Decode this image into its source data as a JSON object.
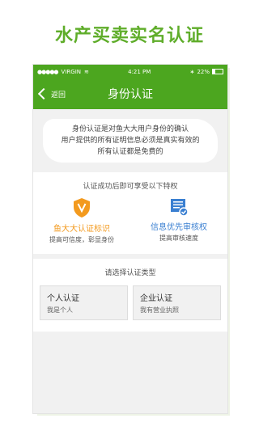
{
  "promo": {
    "title": "水产买卖实名认证"
  },
  "statusbar": {
    "carrier": "VIRGIN",
    "time": "4:21 PM",
    "battery": "22%"
  },
  "navbar": {
    "back_label": "返回",
    "title": "身份认证"
  },
  "notice": {
    "line1": "身份认证是对鱼大大用户身份的确认",
    "line2": "用户提供的所有证明信息必须是真实有效的",
    "line3": "所有认证都是免费的"
  },
  "perks": {
    "title": "认证成功后即可享受以下特权",
    "items": [
      {
        "name": "鱼大大认证标识",
        "desc": "提高可信度，彰显身份",
        "color": "#f39a1e",
        "icon": "shield-v-icon"
      },
      {
        "name": "信息优先审核权",
        "desc": "提高审核速度",
        "color": "#3a7fd1",
        "icon": "document-check-icon"
      }
    ]
  },
  "types": {
    "title": "请选择认证类型",
    "items": [
      {
        "title": "个人认证",
        "subtitle": "我是个人"
      },
      {
        "title": "企业认证",
        "subtitle": "我有营业执照"
      }
    ]
  },
  "colors": {
    "brand_green": "#4ca61f",
    "promo_green": "#5fad2a"
  }
}
